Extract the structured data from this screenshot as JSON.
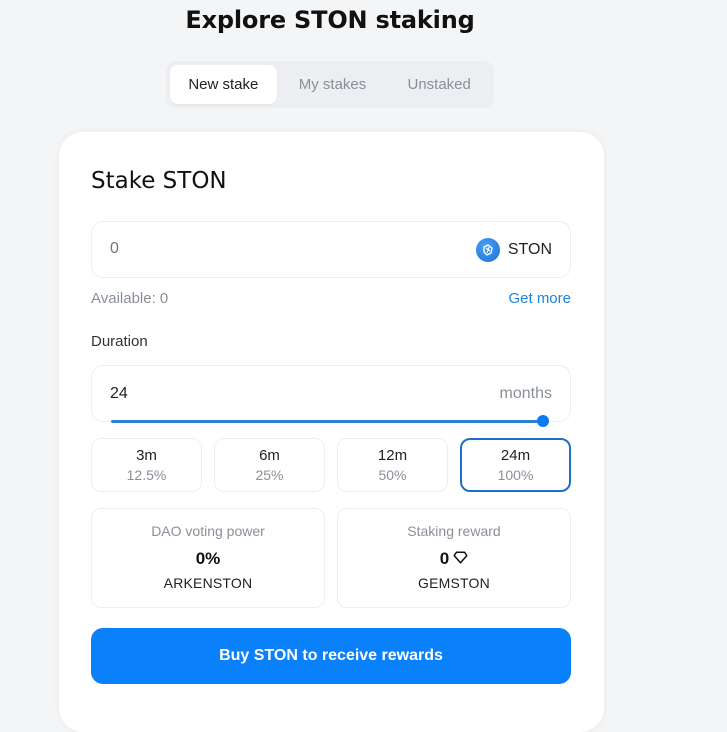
{
  "header": {
    "title": "Explore STON staking"
  },
  "tabs": [
    {
      "label": "New stake",
      "active": true
    },
    {
      "label": "My stakes",
      "active": false
    },
    {
      "label": "Unstaked",
      "active": false
    }
  ],
  "stake_card": {
    "title": "Stake STON",
    "amount": {
      "placeholder": "0",
      "value": "",
      "token_icon": "ston-token-icon",
      "token_symbol": "STON"
    },
    "available_label": "Available: 0",
    "get_more_label": "Get more",
    "duration": {
      "label": "Duration",
      "value": "24",
      "unit": "months",
      "slider_fraction": 1.0
    },
    "presets": [
      {
        "duration": "3m",
        "percent": "12.5%",
        "active": false
      },
      {
        "duration": "6m",
        "percent": "25%",
        "active": false
      },
      {
        "duration": "12m",
        "percent": "50%",
        "active": false
      },
      {
        "duration": "24m",
        "percent": "100%",
        "active": true
      }
    ],
    "stats": [
      {
        "label": "DAO voting power",
        "value": "0%",
        "unit": "ARKENSTON",
        "icon": null
      },
      {
        "label": "Staking reward",
        "value": "0",
        "unit": "GEMSTON",
        "icon": "gem-icon"
      }
    ],
    "cta_label": "Buy STON to receive rewards"
  },
  "colors": {
    "accent": "#0b80fb",
    "link": "#1f85d6",
    "active_border": "#1f6fc7",
    "background": "#f4f5f7"
  }
}
